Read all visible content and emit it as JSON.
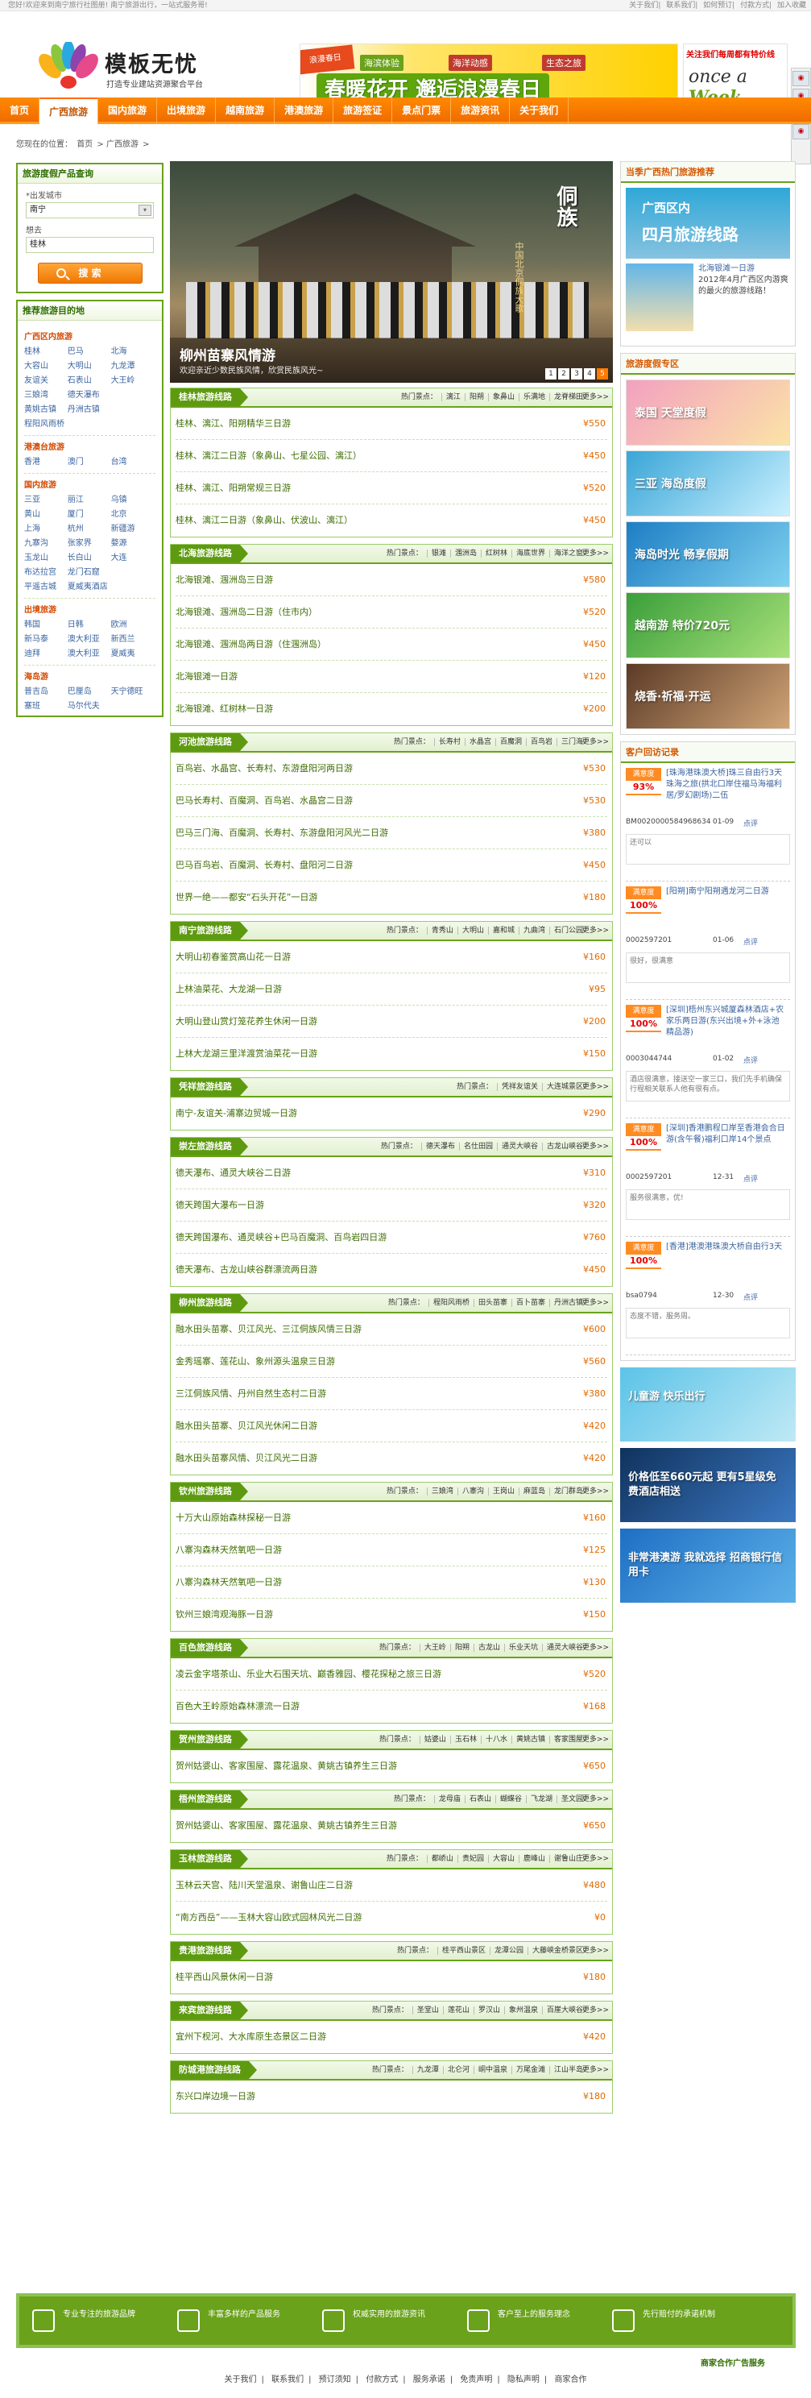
{
  "topbar": {
    "welcome": "您好!欢迎来到南宁旅行社图册!",
    "tagline": "南宁旅游出行，一站式服务哥!",
    "links": [
      "关于我们",
      "联系我们",
      "如何预订",
      "付款方式",
      "加入收藏"
    ]
  },
  "header": {
    "logo_name": "模板无忧",
    "logo_slogan": "打造专业建站资源聚合平台",
    "banner": {
      "tag1": "海滨体验",
      "tag2": "海洋动感",
      "tag3": "生态之旅",
      "main": "春暖花开 邂逅浪漫春日",
      "seal": "浪漫春日"
    },
    "ad2": {
      "title": "关注我们每周都有特价线",
      "brand_a": "once a",
      "brand_b": "Week"
    }
  },
  "nav": [
    "首页",
    "广西旅游",
    "国内旅游",
    "出境旅游",
    "越南旅游",
    "港澳旅游",
    "旅游签证",
    "景点门票",
    "旅游资讯",
    "关于我们"
  ],
  "nav_active": 1,
  "breadcrumb": {
    "prefix": "您现在的位置：",
    "home": "首页",
    "current": "广西旅游"
  },
  "search": {
    "title": "旅游度假产品查询",
    "from_label": "*出发城市",
    "from_value": "南宁",
    "to_label": "想去",
    "to_value": "桂林",
    "button": "搜 索"
  },
  "dest": {
    "title": "推荐旅游目的地",
    "groups": [
      {
        "name": "广西区内旅游",
        "cities": [
          "桂林",
          "巴马",
          "北海",
          "大容山",
          "大明山",
          "九龙潭",
          "友谊关",
          "石表山",
          "大王岭",
          "三娘湾",
          "德天瀑布",
          "",
          "黄姚古镇",
          "丹洲古镇",
          "",
          "程阳风雨桥"
        ]
      },
      {
        "name": "港澳台旅游",
        "cities": [
          "香港",
          "澳门",
          "台湾"
        ]
      },
      {
        "name": "国内旅游",
        "cities": [
          "三亚",
          "丽江",
          "乌镇",
          "黄山",
          "厦门",
          "北京",
          "上海",
          "杭州",
          "新疆游",
          "九寨沟",
          "张家界",
          "婺源",
          "玉龙山",
          "长白山",
          "大连",
          "布达拉宫",
          "龙门石窟",
          "",
          "平遥古城",
          "夏威夷酒店"
        ]
      },
      {
        "name": "出境旅游",
        "cities": [
          "韩国",
          "日韩",
          "欧洲",
          "新马泰",
          "澳大利亚",
          "新西兰",
          "迪拜",
          "澳大利亚",
          "夏威夷"
        ]
      },
      {
        "name": "海岛游",
        "cities": [
          "普吉岛",
          "巴厘岛",
          "天宁德旺",
          "塞班",
          "马尔代夫"
        ]
      }
    ]
  },
  "slider": {
    "title": "柳州苗寨风情游",
    "subtitle": "欢迎亲近少数民族风情，欣赏民族风光~",
    "vtext": "侗族",
    "vtext2": "中国北京侗族大歌",
    "pages": [
      "1",
      "2",
      "3",
      "4",
      "5"
    ],
    "active_page": 4
  },
  "spots_label": "热门景点：",
  "more_label": "更多>>",
  "sections": [
    {
      "title": "桂林旅游线路",
      "spots": [
        "漓江",
        "阳朔",
        "象鼻山",
        "乐满地",
        "龙脊梯田"
      ],
      "rows": [
        {
          "name": "桂林、漓江、阳朔精华三日游",
          "price": "¥550"
        },
        {
          "name": "桂林、漓江二日游（象鼻山、七星公园、漓江）",
          "price": "¥450"
        },
        {
          "name": "桂林、漓江、阳朔常规三日游",
          "price": "¥520"
        },
        {
          "name": "桂林、漓江二日游（象鼻山、伏波山、漓江）",
          "price": "¥450"
        }
      ]
    },
    {
      "title": "北海旅游线路",
      "spots": [
        "银滩",
        "涠洲岛",
        "红树林",
        "海底世界",
        "海洋之窗"
      ],
      "rows": [
        {
          "name": "北海银滩、涠洲岛三日游",
          "price": "¥580"
        },
        {
          "name": "北海银滩、涠洲岛二日游（住市内）",
          "price": "¥520"
        },
        {
          "name": "北海银滩、涠洲岛两日游（住涠洲岛）",
          "price": "¥450"
        },
        {
          "name": "北海银滩一日游",
          "price": "¥120"
        },
        {
          "name": "北海银滩、红树林一日游",
          "price": "¥200"
        }
      ]
    },
    {
      "title": "河池旅游线路",
      "spots": [
        "长寿村",
        "水晶宫",
        "百魔洞",
        "百鸟岩",
        "三门海"
      ],
      "rows": [
        {
          "name": "百鸟岩、水晶宫、长寿村、东游盘阳河两日游",
          "price": "¥530"
        },
        {
          "name": "巴马长寿村、百魔洞、百鸟岩、水晶宫二日游",
          "price": "¥530"
        },
        {
          "name": "巴马三门海、百魔洞、长寿村、东游盘阳河风光二日游",
          "price": "¥380"
        },
        {
          "name": "巴马百鸟岩、百魔洞、长寿村、盘阳河二日游",
          "price": "¥450"
        },
        {
          "name": "世界一绝——都安“石头开花”一日游",
          "price": "¥180"
        }
      ]
    },
    {
      "title": "南宁旅游线路",
      "spots": [
        "青秀山",
        "大明山",
        "嘉和城",
        "九曲湾",
        "石门公园"
      ],
      "rows": [
        {
          "name": "大明山初春鉴赏高山花一日游",
          "price": "¥160"
        },
        {
          "name": "上林油菜花、大龙湖一日游",
          "price": "¥95"
        },
        {
          "name": "大明山登山赏灯笼花养生休闲一日游",
          "price": "¥200"
        },
        {
          "name": "上林大龙湖三里洋渡赏油菜花一日游",
          "price": "¥150"
        }
      ]
    },
    {
      "title": "凭祥旅游线路",
      "spots": [
        "凭祥友谊关",
        "大连城景区"
      ],
      "rows": [
        {
          "name": "南宁-友谊关-浦寨边贸城一日游",
          "price": "¥290"
        }
      ]
    },
    {
      "title": "崇左旅游线路",
      "spots": [
        "德天瀑布",
        "名仕田园",
        "通灵大峡谷",
        "古龙山峡谷"
      ],
      "rows": [
        {
          "name": "德天瀑布、通灵大峡谷二日游",
          "price": "¥310"
        },
        {
          "name": "德天跨国大瀑布一日游",
          "price": "¥320"
        },
        {
          "name": "德天跨国瀑布、通灵峡谷+巴马百魔洞、百鸟岩四日游",
          "price": "¥760"
        },
        {
          "name": "德天瀑布、古龙山峡谷群漂流两日游",
          "price": "¥450"
        }
      ]
    },
    {
      "title": "柳州旅游线路",
      "spots": [
        "程阳风雨桥",
        "田头苗寨",
        "百卜苗寨",
        "丹洲古镇"
      ],
      "rows": [
        {
          "name": "融水田头苗寨、贝江风光、三江侗族风情三日游",
          "price": "¥600"
        },
        {
          "name": "金秀瑶寨、莲花山、象州源头温泉三日游",
          "price": "¥560"
        },
        {
          "name": "三江侗族风情、丹州自然生态村二日游",
          "price": "¥380"
        },
        {
          "name": "融水田头苗寨、贝江风光休闲二日游",
          "price": "¥420"
        },
        {
          "name": "融水田头苗寨风情、贝江风光二日游",
          "price": "¥420"
        }
      ]
    },
    {
      "title": "钦州旅游线路",
      "spots": [
        "三娘湾",
        "八寨沟",
        "王岗山",
        "麻蓝岛",
        "龙门群岛"
      ],
      "rows": [
        {
          "name": "十万大山原始森林探秘一日游",
          "price": "¥160"
        },
        {
          "name": "八寨沟森林天然氧吧一日游",
          "price": "¥125"
        },
        {
          "name": "八寨沟森林天然氧吧一日游",
          "price": "¥130"
        },
        {
          "name": "钦州三娘湾观海豚一日游",
          "price": "¥150"
        }
      ]
    },
    {
      "title": "百色旅游线路",
      "spots": [
        "大王岭",
        "阳朔",
        "古龙山",
        "乐业天坑",
        "通灵大峡谷"
      ],
      "rows": [
        {
          "name": "凌云金字塔茶山、乐业大石围天坑、巅香雅园、樱花探秘之旅三日游",
          "price": "¥520"
        },
        {
          "name": "百色大王岭原始森林漂流一日游",
          "price": "¥168"
        }
      ]
    },
    {
      "title": "贺州旅游线路",
      "spots": [
        "姑婆山",
        "玉石林",
        "十八水",
        "黄姚古镇",
        "客家围屋"
      ],
      "rows": [
        {
          "name": "贺州姑婆山、客家围屋、露花温泉、黄姚古镇养生三日游",
          "price": "¥650"
        }
      ]
    },
    {
      "title": "梧州旅游线路",
      "spots": [
        "龙母庙",
        "石表山",
        "蝴蝶谷",
        "飞龙湖",
        "圣文园"
      ],
      "rows": [
        {
          "name": "贺州姑婆山、客家围屋、露花温泉、黄姚古镇养生三日游",
          "price": "¥650"
        }
      ]
    },
    {
      "title": "玉林旅游线路",
      "spots": [
        "都峤山",
        "贵妃园",
        "大容山",
        "鹿峰山",
        "谢鲁山庄"
      ],
      "rows": [
        {
          "name": "玉林云天宫、陆川天堂温泉、谢鲁山庄二日游",
          "price": "¥480"
        },
        {
          "name": "“南方西岳”——玉林大容山欧式园林风光二日游",
          "price": "¥0"
        }
      ]
    },
    {
      "title": "贵港旅游线路",
      "spots": [
        "桂平西山景区",
        "龙潭公园",
        "大藤峡金桥景区"
      ],
      "rows": [
        {
          "name": "桂平西山风景休闲一日游",
          "price": "¥180"
        }
      ]
    },
    {
      "title": "来宾旅游线路",
      "spots": [
        "圣堂山",
        "莲花山",
        "罗汉山",
        "象州温泉",
        "百崖大峡谷"
      ],
      "rows": [
        {
          "name": "宜州下枧河、大水库原生态景区二日游",
          "price": "¥420"
        }
      ]
    },
    {
      "title": "防城港旅游线路",
      "spots": [
        "九龙潭",
        "北仑河",
        "峒中温泉",
        "万尾金滩",
        "江山半岛"
      ],
      "rows": [
        {
          "name": "东兴口岸边境一日游",
          "price": "¥180"
        }
      ]
    }
  ],
  "right": {
    "hot_title": "当季广西热门旅游推荐",
    "hot_big_a": "广西区内",
    "hot_big_b": "四月旅游线路",
    "hot_item_title": "北海银滩一日游",
    "hot_item_desc": "2012年4月广西区内游爽的最火的旅游线路！",
    "promo_title": "旅游度假专区",
    "promos": [
      {
        "text": "泰国 天堂度假",
        "c1": "#f3a1c0",
        "c2": "#fbe3a6"
      },
      {
        "text": "三亚 海岛度假",
        "c1": "#3aa6d7",
        "c2": "#c9f0ff"
      },
      {
        "text": "海岛时光 畅享假期",
        "c1": "#1d7ec4",
        "c2": "#7fd1ef"
      },
      {
        "text": "越南游 特价720元",
        "c1": "#3a9f3a",
        "c2": "#a8e07a"
      },
      {
        "text": "烧香·祈福·开运",
        "c1": "#5b3a26",
        "c2": "#d1a577"
      }
    ],
    "visits_title": "客户回访记录",
    "visits": [
      {
        "label": "满意度",
        "pct": "93%",
        "title": "[珠海港珠澳大桥]珠三自由行3天珠海之旅(拱北口岸住福马海福利居/罗幻剧场)二伍",
        "order": "BM0020000584968634",
        "date": "01-09",
        "rate": "点评",
        "comment": "还可以"
      },
      {
        "label": "满意度",
        "pct": "100%",
        "title": "[阳朔]南宁阳朔遇龙河二日游",
        "order": "0002597201",
        "date": "01-06",
        "rate": "点评",
        "comment": "很好，很满意"
      },
      {
        "label": "满意度",
        "pct": "100%",
        "title": "[深圳]梧州东兴城厦森林酒店+农家乐两日游(东兴出境+外+泳池精品游)",
        "order": "0003044744",
        "date": "01-02",
        "rate": "点评",
        "comment": "酒店很满意，接送空一家三口，我们先手机确保行程相关联系人他有很有点。"
      },
      {
        "label": "满意度",
        "pct": "100%",
        "title": "[深圳]香港鹏程口岸至香港会合日游(含午餐)福利口岸14个景点",
        "order": "0002597201",
        "date": "12-31",
        "rate": "点评",
        "comment": "服务很满意，优!"
      },
      {
        "label": "满意度",
        "pct": "100%",
        "title": "[香港]港澳港珠澳大桥自由行3天",
        "order": "bsa0794",
        "date": "12-30",
        "rate": "点评",
        "comment": "态度不错，服务周。"
      }
    ],
    "ads": [
      {
        "text": "儿童游 快乐出行",
        "c1": "#5cc3e8",
        "c2": "#bfe9f5"
      },
      {
        "text": "价格低至660元起 更有5星级免费酒店相送",
        "c1": "#10335e",
        "c2": "#3b78c2"
      },
      {
        "text": "非常港澳游 我就选择 招商银行信用卡",
        "c1": "#1e6fc4",
        "c2": "#5db1e8"
      }
    ]
  },
  "footer_features": [
    "专业专注的旅游品牌",
    "丰富多样的产品服务",
    "权威实用的旅游资讯",
    "客户至上的服务理念",
    "先行赔付的承诺机制"
  ],
  "coop": "商家合作广告服务",
  "bottom_links": [
    "关于我们",
    "联系我们",
    "预订须知",
    "付款方式",
    "服务承诺",
    "免责声明",
    "隐私声明",
    "商家合作"
  ]
}
